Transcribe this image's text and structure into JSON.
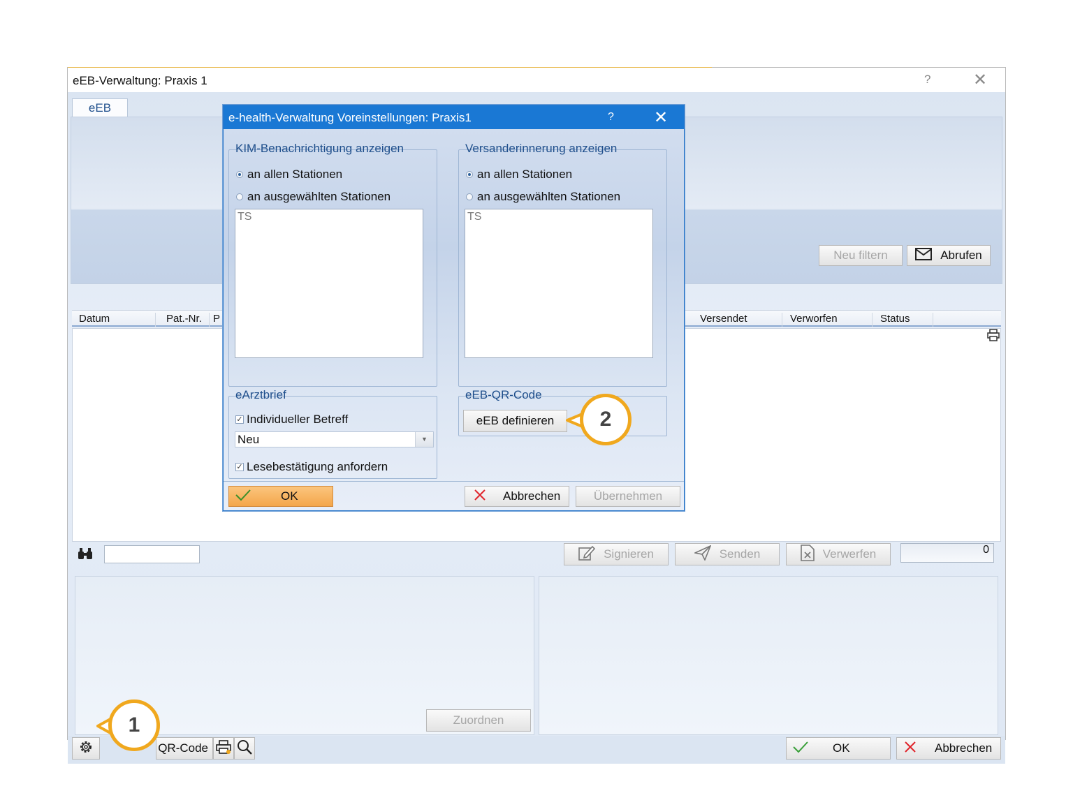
{
  "main": {
    "title": "eEB-Verwaltung: Praxis 1",
    "help": "?",
    "close": "✕",
    "tab": "eEB",
    "buttons": {
      "neu_filtern": "Neu filtern",
      "abrufen": "Abrufen"
    },
    "columns_left": [
      "Datum",
      "Pat.-Nr.",
      "P"
    ],
    "columns_right": [
      "Versendet",
      "Verworfen",
      "Status"
    ],
    "actions": {
      "signieren": "Signieren",
      "senden": "Senden",
      "verwerfen": "Verwerfen"
    },
    "counter": "0",
    "zuordnen": "Zuordnen",
    "bottom": {
      "qr_code": "QR-Code",
      "ok": "OK",
      "abbrechen": "Abbrechen"
    }
  },
  "dialog": {
    "title": "e-health-Verwaltung Voreinstellungen: Praxis1",
    "help": "?",
    "close": "✕",
    "kim": {
      "legend": "KIM-Benachrichtigung anzeigen",
      "opt_all": "an allen Stationen",
      "opt_selected": "an ausgewählten Stationen",
      "selected": "all",
      "list_item": "TS"
    },
    "versand": {
      "legend": "Versanderinnerung anzeigen",
      "opt_all": "an allen Stationen",
      "opt_selected": "an ausgewählten Stationen",
      "selected": "all",
      "list_item": "TS"
    },
    "earztbrief": {
      "legend": "eArztbrief",
      "individueller_betreff": "Individueller Betreff",
      "individueller_checked": true,
      "betreff_value": "Neu",
      "lesebestaetigung": "Lesebestätigung anfordern",
      "lesebestaetigung_checked": true
    },
    "qr": {
      "legend": "eEB-QR-Code",
      "button": "eEB definieren"
    },
    "buttons": {
      "ok": "OK",
      "abbrechen": "Abbrechen",
      "uebernehmen": "Übernehmen"
    }
  },
  "callouts": [
    "1",
    "2"
  ],
  "colors": {
    "accent": "#1a78d4",
    "callout": "#f0a81e",
    "ok_button": "#f7a74a"
  }
}
